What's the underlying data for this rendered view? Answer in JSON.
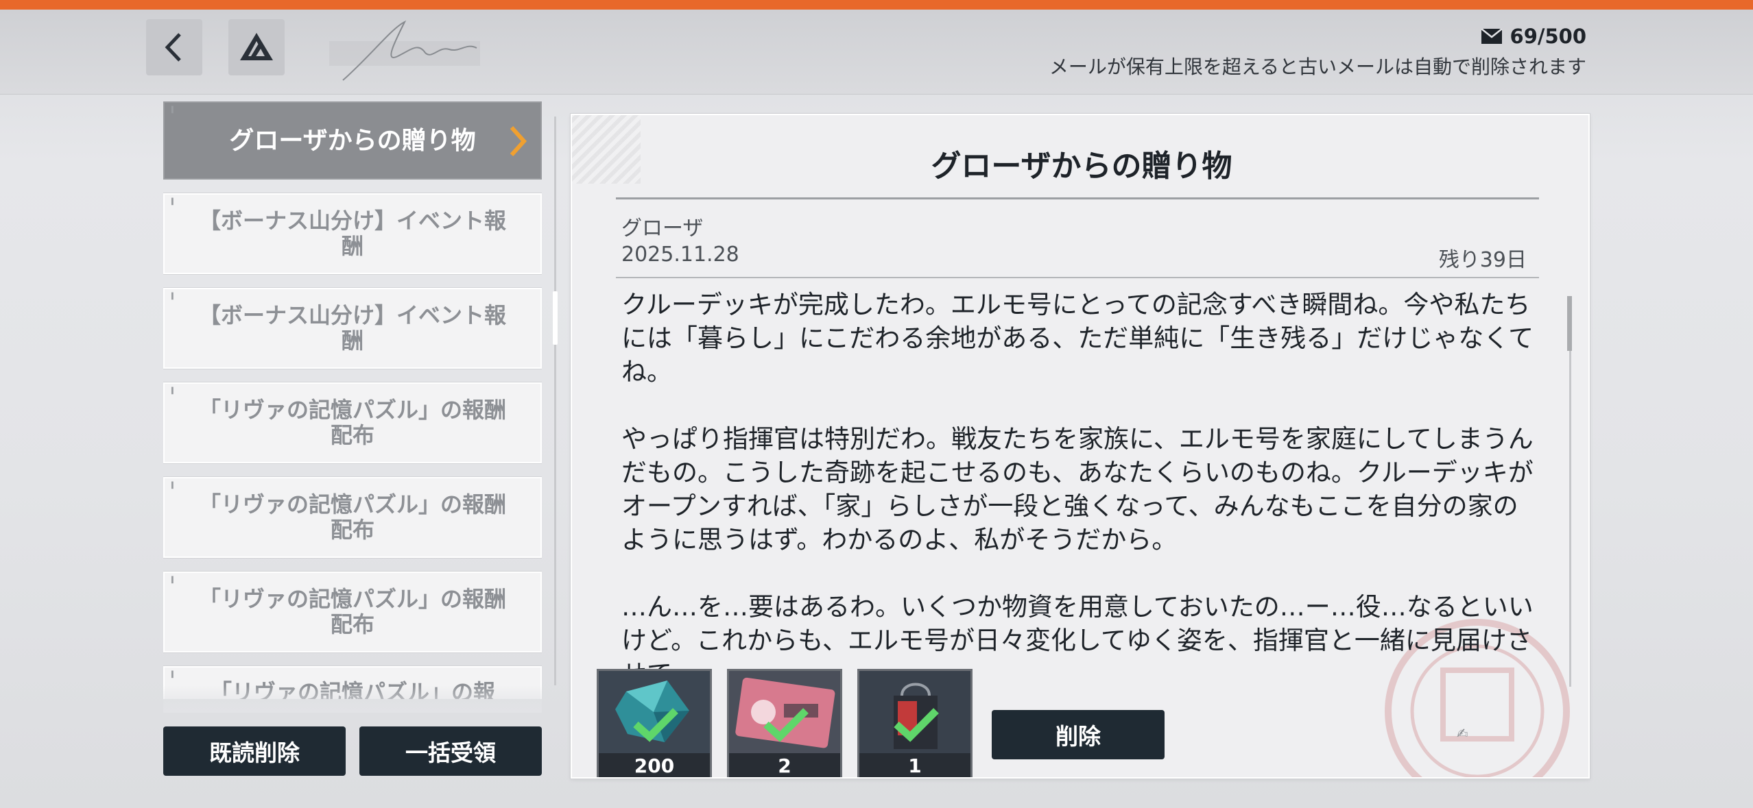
{
  "header": {
    "mail_count": "69/500",
    "mail_note": "メールが保有上限を超えると古いメールは自動で削除されます"
  },
  "mail_list": {
    "items": [
      {
        "label": "グローザからの贈り物",
        "active": true
      },
      {
        "label": "【ボーナス山分け】イベント報酬",
        "active": false
      },
      {
        "label": "【ボーナス山分け】イベント報酬",
        "active": false
      },
      {
        "label": "「リヴァの記憶パズル」の報酬配布",
        "active": false
      },
      {
        "label": "「リヴァの記憶パズル」の報酬配布",
        "active": false
      },
      {
        "label": "「リヴァの記憶パズル」の報酬配布",
        "active": false
      },
      {
        "label": "「リヴァの記憶パズル」の報",
        "active": false
      }
    ],
    "delete_read_label": "既読削除",
    "claim_all_label": "一括受領"
  },
  "mail_detail": {
    "title": "グローザからの贈り物",
    "sender": "グローザ",
    "date": "2025.11.28",
    "remaining": "残り39日",
    "paragraphs": [
      "クルーデッキが完成したわ。エルモ号にとっての記念すべき瞬間ね。今や私たちには「暮らし」にこだわる余地がある、ただ単純に「生き残る」だけじゃなくてね。",
      "やっぱり指揮官は特別だわ。戦友たちを家族に、エルモ号を家庭にしてしまうんだもの。こうした奇跡を起こせるのも、あなたくらいのものね。クルーデッキがオープンすれば、「家」らしさが一段と強くなって、みんなもここを自分の家のように思うはず。わかるのよ、私がそうだから。",
      "…ん…を…要はあるわ。いくつか物資を用意しておいたの…ー…役…なるといいけど。これからも、エルモ号が日々変化してゆく姿を、指揮官と一緒に見届けさせて。"
    ],
    "delete_label": "削除"
  },
  "rewards": [
    {
      "quantity": "200",
      "icon": "crystal-icon",
      "claimed": true,
      "rarity_color": "#e0a83a"
    },
    {
      "quantity": "2",
      "icon": "elmo-ticket-icon",
      "claimed": true,
      "rarity_color": "#e0a83a"
    },
    {
      "quantity": "1",
      "icon": "gift-bag-icon",
      "claimed": true,
      "rarity_color": "#8a63c9"
    }
  ],
  "colors": {
    "accent": "#e8682a",
    "button_dark": "#1f2a33",
    "claimed_check": "#5fd66a"
  }
}
